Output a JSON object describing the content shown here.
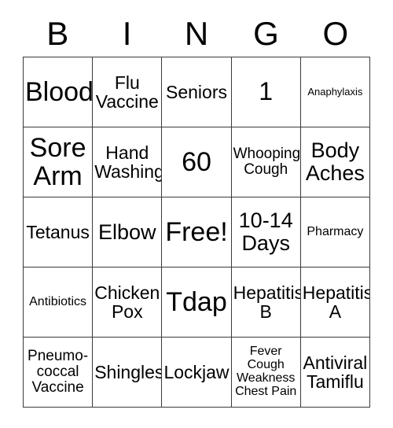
{
  "card": {
    "title": "BINGO",
    "header_letters": [
      "B",
      "I",
      "N",
      "G",
      "O"
    ],
    "free_space_label": "Free!",
    "border_color": "#3a3a3a",
    "background_color": "#ffffff",
    "text_color": "#000000",
    "rows": 5,
    "columns": 5,
    "cells": [
      [
        {
          "text": "Blood",
          "size": "fs-xxl"
        },
        {
          "text": "Flu\nVaccine",
          "size": "fs-md"
        },
        {
          "text": "Seniors",
          "size": "fs-md"
        },
        {
          "text": "1",
          "size": "fs-xl"
        },
        {
          "text": "Anaphylaxis",
          "size": "fs-xxs"
        }
      ],
      [
        {
          "text": "Sore\nArm",
          "size": "fs-xxl"
        },
        {
          "text": "Hand\nWashing",
          "size": "fs-md"
        },
        {
          "text": "60",
          "size": "fs-xxl"
        },
        {
          "text": "Whooping\nCough",
          "size": "fs-sm"
        },
        {
          "text": "Body\nAches",
          "size": "fs-lg"
        }
      ],
      [
        {
          "text": "Tetanus",
          "size": "fs-md"
        },
        {
          "text": "Elbow",
          "size": "fs-lg"
        },
        {
          "text": "Free!",
          "size": "fs-xxl"
        },
        {
          "text": "10-14\nDays",
          "size": "fs-lg"
        },
        {
          "text": "Pharmacy",
          "size": "fs-xs"
        }
      ],
      [
        {
          "text": "Antibiotics",
          "size": "fs-xs"
        },
        {
          "text": "Chicken\nPox",
          "size": "fs-md"
        },
        {
          "text": "Tdap",
          "size": "fs-xxl"
        },
        {
          "text": "Hepatitis\nB",
          "size": "fs-md"
        },
        {
          "text": "Hepatitis\nA",
          "size": "fs-md"
        }
      ],
      [
        {
          "text": "Pneumo-\ncoccal\nVaccine",
          "size": "fs-sm"
        },
        {
          "text": "Shingles",
          "size": "fs-md"
        },
        {
          "text": "Lockjaw",
          "size": "fs-md"
        },
        {
          "text": "Fever\nCough\nWeakness\nChest Pain",
          "size": "fs-xs"
        },
        {
          "text": "Antiviral\nTamiflu",
          "size": "fs-md"
        }
      ]
    ]
  }
}
